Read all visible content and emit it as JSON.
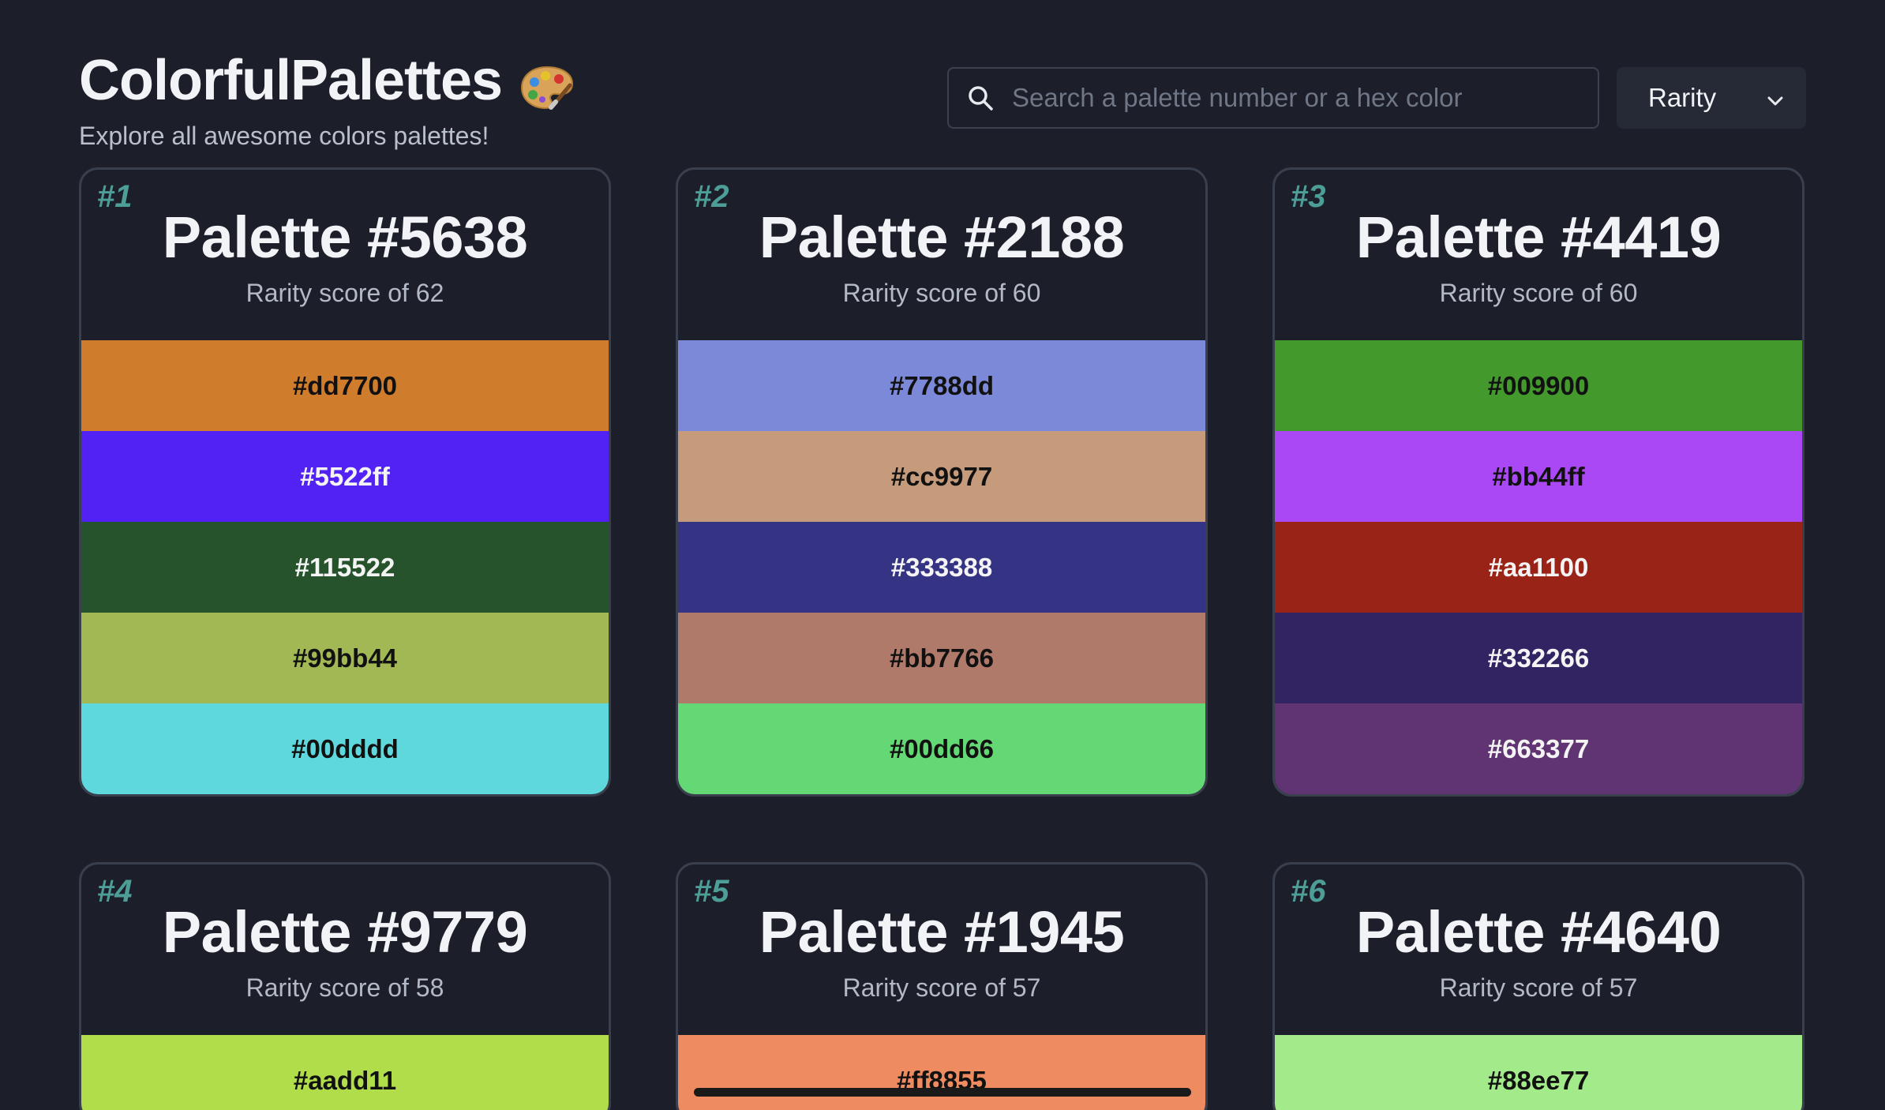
{
  "header": {
    "title": "ColorfulPalettes",
    "subtitle": "Explore all awesome colors palettes!"
  },
  "search": {
    "placeholder": "Search a palette number or a hex color",
    "value": ""
  },
  "sort": {
    "selected": "Rarity"
  },
  "palettes": [
    {
      "rank": "#1",
      "title": "Palette #5638",
      "rarity": "Rarity score of 62",
      "colors": [
        {
          "hex": "#dd7700",
          "display": "#d07c2d",
          "text": "dark"
        },
        {
          "hex": "#5522ff",
          "display": "#5222f5",
          "text": "light"
        },
        {
          "hex": "#115522",
          "display": "#26522c",
          "text": "light"
        },
        {
          "hex": "#99bb44",
          "display": "#a1b855",
          "text": "dark"
        },
        {
          "hex": "#00dddd",
          "display": "#5ed8dc",
          "text": "dark"
        }
      ]
    },
    {
      "rank": "#2",
      "title": "Palette #2188",
      "rarity": "Rarity score of 60",
      "colors": [
        {
          "hex": "#7788dd",
          "display": "#7c88d8",
          "text": "dark"
        },
        {
          "hex": "#cc9977",
          "display": "#c59b7c",
          "text": "dark"
        },
        {
          "hex": "#333388",
          "display": "#353384",
          "text": "light"
        },
        {
          "hex": "#bb7766",
          "display": "#b07a6b",
          "text": "dark"
        },
        {
          "hex": "#00dd66",
          "display": "#64d874",
          "text": "dark"
        }
      ]
    },
    {
      "rank": "#3",
      "title": "Palette #4419",
      "rarity": "Rarity score of 60",
      "colors": [
        {
          "hex": "#009900",
          "display": "#43992c",
          "text": "dark"
        },
        {
          "hex": "#bb44ff",
          "display": "#ab48f5",
          "text": "dark"
        },
        {
          "hex": "#aa1100",
          "display": "#992317",
          "text": "light"
        },
        {
          "hex": "#332266",
          "display": "#322362",
          "text": "light"
        },
        {
          "hex": "#663377",
          "display": "#603472",
          "text": "light"
        }
      ]
    },
    {
      "rank": "#4",
      "title": "Palette #9779",
      "rarity": "Rarity score of 58",
      "colors": [
        {
          "hex": "#aadd11",
          "display": "#b1dd4a",
          "text": "dark"
        }
      ]
    },
    {
      "rank": "#5",
      "title": "Palette #1945",
      "rarity": "Rarity score of 57",
      "colors": [
        {
          "hex": "#ff8855",
          "display": "#ef8b61",
          "text": "dark"
        }
      ]
    },
    {
      "rank": "#6",
      "title": "Palette #4640",
      "rarity": "Rarity score of 57",
      "colors": [
        {
          "hex": "#88ee77",
          "display": "#a3ea8a",
          "text": "dark"
        }
      ]
    }
  ]
}
